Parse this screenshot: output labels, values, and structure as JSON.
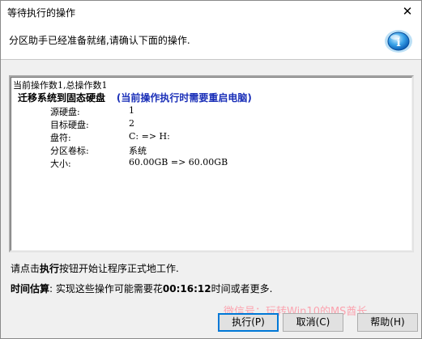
{
  "window": {
    "title": "等待执行的操作",
    "close_glyph": "✕"
  },
  "header": {
    "message": "分区助手已经准备就绪,请确认下面的操作.",
    "icon": "info-icon",
    "icon_glyph": "i"
  },
  "operations": {
    "summary": "当前操作数1,总操作数1",
    "items": [
      {
        "title": "迁移系统到固态硬盘",
        "note": "(当前操作执行时需要重启电脑)",
        "details": [
          {
            "label": "源硬盘:",
            "value": "1"
          },
          {
            "label": "目标硬盘:",
            "value": "2"
          },
          {
            "label": "盘符:",
            "value": "C: => H:"
          },
          {
            "label": "分区卷标:",
            "value": "系统"
          },
          {
            "label": "大小:",
            "value": "60.00GB => 60.00GB"
          }
        ]
      }
    ]
  },
  "instruction": {
    "prefix": "请点击",
    "bold": "执行",
    "suffix": "按钮开始让程序正式地工作."
  },
  "estimate": {
    "label": "时间估算",
    "text_before": ": 实现这些操作可能需要花",
    "time": "00:16:12",
    "text_after": "时间或者更多."
  },
  "watermark": "微信号：玩转Win10的MS酋长",
  "buttons": {
    "execute": "执行(P)",
    "cancel": "取消(C)",
    "help": "帮助(H)"
  },
  "colors": {
    "note_text": "#1a2fb8",
    "primary_button_border": "#0078d7",
    "watermark": "#ff8a9a"
  }
}
